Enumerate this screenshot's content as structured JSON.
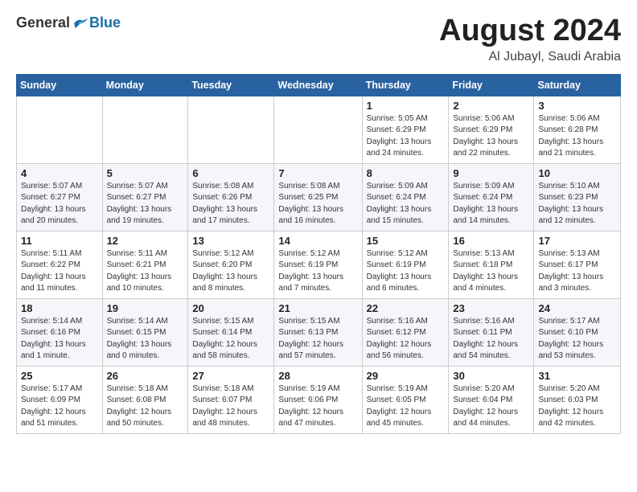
{
  "header": {
    "logo_general": "General",
    "logo_blue": "Blue",
    "month_title": "August 2024",
    "subtitle": "Al Jubayl, Saudi Arabia"
  },
  "weekdays": [
    "Sunday",
    "Monday",
    "Tuesday",
    "Wednesday",
    "Thursday",
    "Friday",
    "Saturday"
  ],
  "weeks": [
    [
      {
        "day": "",
        "detail": ""
      },
      {
        "day": "",
        "detail": ""
      },
      {
        "day": "",
        "detail": ""
      },
      {
        "day": "",
        "detail": ""
      },
      {
        "day": "1",
        "detail": "Sunrise: 5:05 AM\nSunset: 6:29 PM\nDaylight: 13 hours\nand 24 minutes."
      },
      {
        "day": "2",
        "detail": "Sunrise: 5:06 AM\nSunset: 6:29 PM\nDaylight: 13 hours\nand 22 minutes."
      },
      {
        "day": "3",
        "detail": "Sunrise: 5:06 AM\nSunset: 6:28 PM\nDaylight: 13 hours\nand 21 minutes."
      }
    ],
    [
      {
        "day": "4",
        "detail": "Sunrise: 5:07 AM\nSunset: 6:27 PM\nDaylight: 13 hours\nand 20 minutes."
      },
      {
        "day": "5",
        "detail": "Sunrise: 5:07 AM\nSunset: 6:27 PM\nDaylight: 13 hours\nand 19 minutes."
      },
      {
        "day": "6",
        "detail": "Sunrise: 5:08 AM\nSunset: 6:26 PM\nDaylight: 13 hours\nand 17 minutes."
      },
      {
        "day": "7",
        "detail": "Sunrise: 5:08 AM\nSunset: 6:25 PM\nDaylight: 13 hours\nand 16 minutes."
      },
      {
        "day": "8",
        "detail": "Sunrise: 5:09 AM\nSunset: 6:24 PM\nDaylight: 13 hours\nand 15 minutes."
      },
      {
        "day": "9",
        "detail": "Sunrise: 5:09 AM\nSunset: 6:24 PM\nDaylight: 13 hours\nand 14 minutes."
      },
      {
        "day": "10",
        "detail": "Sunrise: 5:10 AM\nSunset: 6:23 PM\nDaylight: 13 hours\nand 12 minutes."
      }
    ],
    [
      {
        "day": "11",
        "detail": "Sunrise: 5:11 AM\nSunset: 6:22 PM\nDaylight: 13 hours\nand 11 minutes."
      },
      {
        "day": "12",
        "detail": "Sunrise: 5:11 AM\nSunset: 6:21 PM\nDaylight: 13 hours\nand 10 minutes."
      },
      {
        "day": "13",
        "detail": "Sunrise: 5:12 AM\nSunset: 6:20 PM\nDaylight: 13 hours\nand 8 minutes."
      },
      {
        "day": "14",
        "detail": "Sunrise: 5:12 AM\nSunset: 6:19 PM\nDaylight: 13 hours\nand 7 minutes."
      },
      {
        "day": "15",
        "detail": "Sunrise: 5:12 AM\nSunset: 6:19 PM\nDaylight: 13 hours\nand 6 minutes."
      },
      {
        "day": "16",
        "detail": "Sunrise: 5:13 AM\nSunset: 6:18 PM\nDaylight: 13 hours\nand 4 minutes."
      },
      {
        "day": "17",
        "detail": "Sunrise: 5:13 AM\nSunset: 6:17 PM\nDaylight: 13 hours\nand 3 minutes."
      }
    ],
    [
      {
        "day": "18",
        "detail": "Sunrise: 5:14 AM\nSunset: 6:16 PM\nDaylight: 13 hours\nand 1 minute."
      },
      {
        "day": "19",
        "detail": "Sunrise: 5:14 AM\nSunset: 6:15 PM\nDaylight: 13 hours\nand 0 minutes."
      },
      {
        "day": "20",
        "detail": "Sunrise: 5:15 AM\nSunset: 6:14 PM\nDaylight: 12 hours\nand 58 minutes."
      },
      {
        "day": "21",
        "detail": "Sunrise: 5:15 AM\nSunset: 6:13 PM\nDaylight: 12 hours\nand 57 minutes."
      },
      {
        "day": "22",
        "detail": "Sunrise: 5:16 AM\nSunset: 6:12 PM\nDaylight: 12 hours\nand 56 minutes."
      },
      {
        "day": "23",
        "detail": "Sunrise: 5:16 AM\nSunset: 6:11 PM\nDaylight: 12 hours\nand 54 minutes."
      },
      {
        "day": "24",
        "detail": "Sunrise: 5:17 AM\nSunset: 6:10 PM\nDaylight: 12 hours\nand 53 minutes."
      }
    ],
    [
      {
        "day": "25",
        "detail": "Sunrise: 5:17 AM\nSunset: 6:09 PM\nDaylight: 12 hours\nand 51 minutes."
      },
      {
        "day": "26",
        "detail": "Sunrise: 5:18 AM\nSunset: 6:08 PM\nDaylight: 12 hours\nand 50 minutes."
      },
      {
        "day": "27",
        "detail": "Sunrise: 5:18 AM\nSunset: 6:07 PM\nDaylight: 12 hours\nand 48 minutes."
      },
      {
        "day": "28",
        "detail": "Sunrise: 5:19 AM\nSunset: 6:06 PM\nDaylight: 12 hours\nand 47 minutes."
      },
      {
        "day": "29",
        "detail": "Sunrise: 5:19 AM\nSunset: 6:05 PM\nDaylight: 12 hours\nand 45 minutes."
      },
      {
        "day": "30",
        "detail": "Sunrise: 5:20 AM\nSunset: 6:04 PM\nDaylight: 12 hours\nand 44 minutes."
      },
      {
        "day": "31",
        "detail": "Sunrise: 5:20 AM\nSunset: 6:03 PM\nDaylight: 12 hours\nand 42 minutes."
      }
    ]
  ]
}
